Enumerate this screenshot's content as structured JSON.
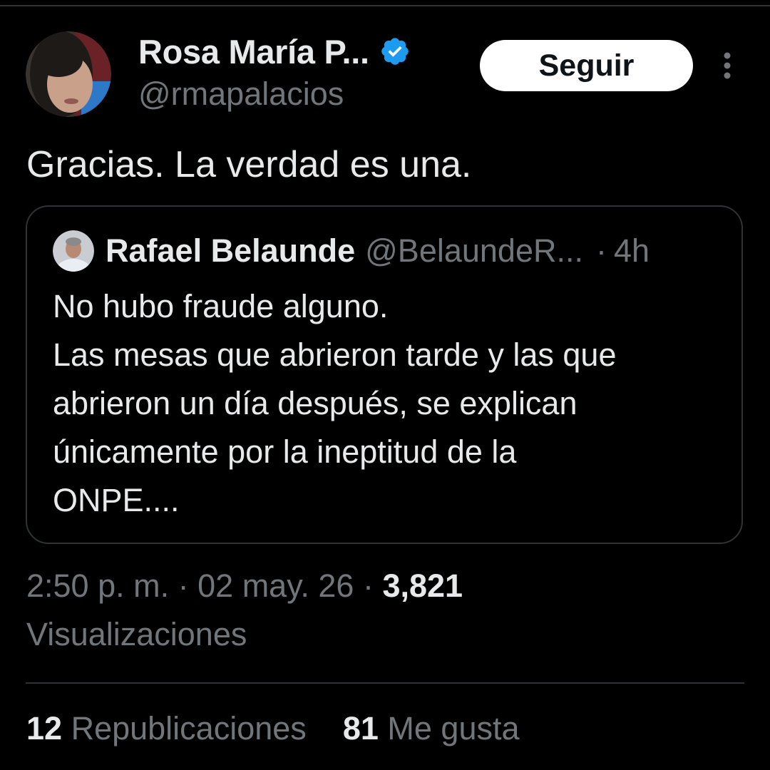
{
  "author": {
    "display_name": "Rosa María P...",
    "handle": "@rmapalacios",
    "verified": true
  },
  "follow_button": {
    "label": "Seguir"
  },
  "tweet": {
    "text": "Gracias. La verdad es una."
  },
  "quoted_tweet": {
    "display_name": "Rafael Belaunde",
    "handle": "@BelaundeR...",
    "separator": "·",
    "time": "4h",
    "lines": [
      "No hubo fraude alguno.",
      "Las mesas que abrieron tarde y las que",
      "abrieron un día después, se explican",
      "únicamente por la ineptitud de la",
      "ONPE...."
    ]
  },
  "meta": {
    "time": "2:50 p. m.",
    "sep1": "·",
    "date": "02 may. 26",
    "sep2": "·",
    "views_count": "3,821",
    "views_label": "Visualizaciones"
  },
  "stats": {
    "reposts_count": "12",
    "reposts_label": "Republicaciones",
    "likes_count": "81",
    "likes_label": "Me gusta"
  },
  "colors": {
    "background": "#000000",
    "text_primary": "#e7e9ea",
    "text_secondary": "#71767b",
    "border": "#2f3336",
    "verified_blue": "#1d9bf0",
    "button_bg": "#ffffff"
  }
}
